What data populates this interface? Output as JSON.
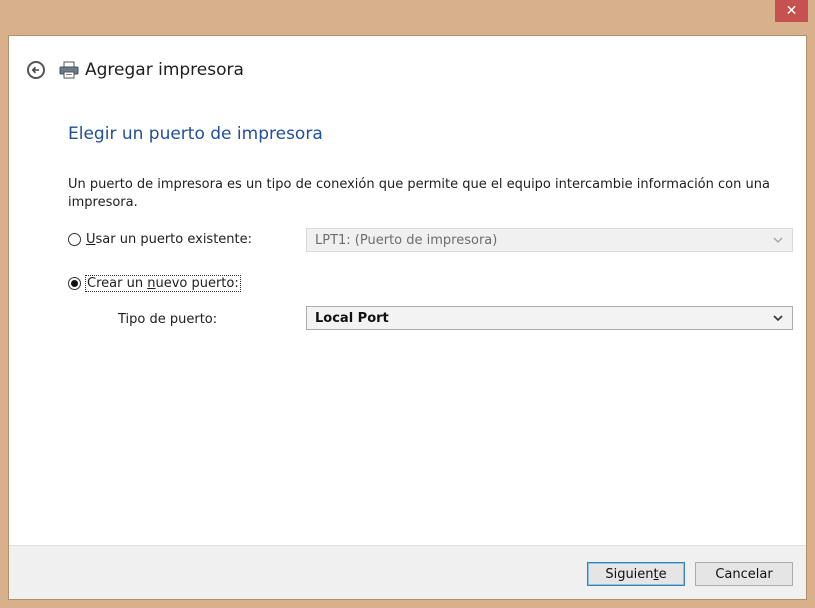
{
  "window": {
    "close_symbol": "✕",
    "accent_color": "#d8b08b",
    "close_color": "#c75050"
  },
  "wizard": {
    "title": "Agregar impresora",
    "back_icon": "back-arrow-icon",
    "printer_icon": "printer-icon"
  },
  "page": {
    "heading": "Elegir un puerto de impresora",
    "heading_color": "#1f4e9c",
    "description": "Un puerto de impresora es un tipo de conexión que permite que el equipo intercambie información con una impresora."
  },
  "existing_port": {
    "label_underlined": "U",
    "label_rest": "sar un puerto existente:",
    "selected": false,
    "select_value": "LPT1: (Puerto de impresora)",
    "enabled": false
  },
  "new_port": {
    "label_prefix": "Crear un ",
    "label_underlined": "n",
    "label_suffix": "uevo puerto:",
    "selected": true,
    "type_label": "Tipo de puerto:",
    "select_value": "Local Port"
  },
  "footer": {
    "next_prefix": "Siguien",
    "next_underlined": "t",
    "next_suffix": "e",
    "cancel_label": "Cancelar"
  }
}
